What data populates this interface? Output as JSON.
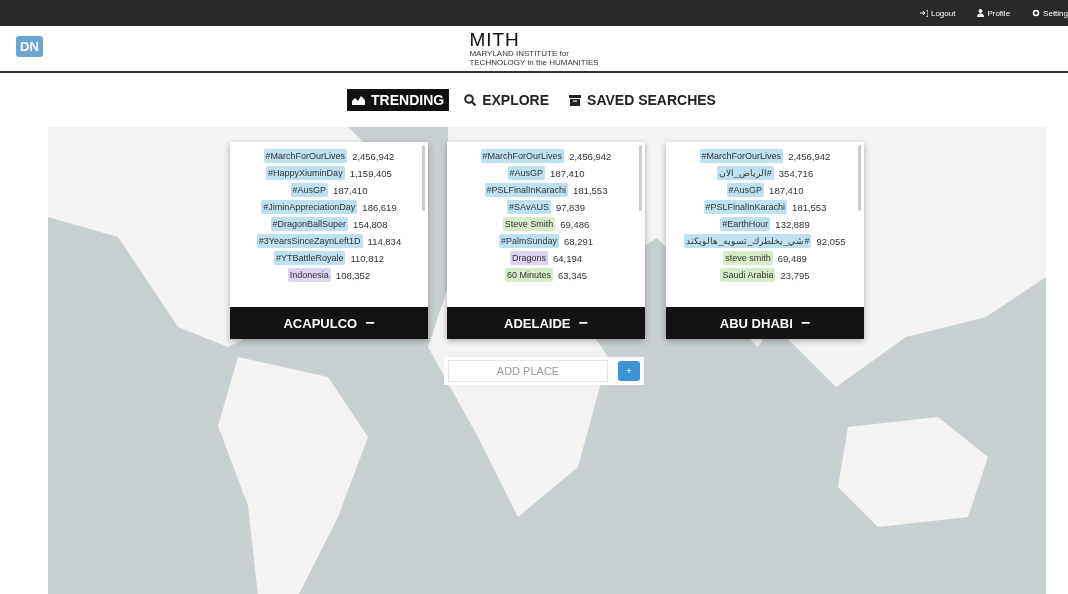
{
  "top_bar": {
    "links": [
      {
        "label": "Logout",
        "kind": "logout"
      },
      {
        "label": "Profile",
        "kind": "person"
      },
      {
        "label": "Setting",
        "kind": "gear"
      }
    ]
  },
  "header": {
    "badge": "DN",
    "logo_title": "MITH",
    "logo_subtitle": [
      "MARYLAND INSTITUTE for",
      "TECHNOLOGY in the HUMANITIES"
    ]
  },
  "tabs": [
    {
      "label": "TRENDING",
      "kind": "chart",
      "selected": true
    },
    {
      "label": "EXPLORE",
      "kind": "search",
      "selected": false
    },
    {
      "label": "SAVED SEARCHES",
      "kind": "box",
      "selected": false
    }
  ],
  "places": [
    {
      "name": "ACAPULCO",
      "collapse": "−",
      "trends": [
        {
          "tag": "#MarchForOurLives",
          "count": "2,456,942",
          "kind": "hashtag"
        },
        {
          "tag": "#HappyXiuminDay",
          "count": "1,159,405",
          "kind": "hashtag"
        },
        {
          "tag": "#AusGP",
          "count": "187,410",
          "kind": "hashtag"
        },
        {
          "tag": "#JiminAppreciationDay",
          "count": "186,619",
          "kind": "hashtag"
        },
        {
          "tag": "#DragonBallSuper",
          "count": "154,808",
          "kind": "hashtag"
        },
        {
          "tag": "#3YearsSinceZaynLeft1D",
          "count": "114,834",
          "kind": "hashtag"
        },
        {
          "tag": "#YTBattleRoyale",
          "count": "110,812",
          "kind": "hashtag"
        },
        {
          "tag": "Indonesia",
          "count": "108,352",
          "kind": "place"
        }
      ]
    },
    {
      "name": "ADELAIDE",
      "collapse": "−",
      "trends": [
        {
          "tag": "#MarchForOurLives",
          "count": "2,456,942",
          "kind": "hashtag"
        },
        {
          "tag": "#AusGP",
          "count": "187,410",
          "kind": "hashtag"
        },
        {
          "tag": "#PSLFinalInKarachi",
          "count": "181,553",
          "kind": "hashtag"
        },
        {
          "tag": "#SAvAUS",
          "count": "97,839",
          "kind": "hashtag"
        },
        {
          "tag": "Steve Smith",
          "count": "69,486",
          "kind": "person"
        },
        {
          "tag": "#PalmSunday",
          "count": "68,291",
          "kind": "hashtag"
        },
        {
          "tag": "Dragons",
          "count": "64,194",
          "kind": "place"
        },
        {
          "tag": "60 Minutes",
          "count": "63,345",
          "kind": "person"
        }
      ]
    },
    {
      "name": "ABU DHABI",
      "collapse": "−",
      "trends": [
        {
          "tag": "#MarchForOurLives",
          "count": "2,456,942",
          "kind": "hashtag"
        },
        {
          "tag": "#الرياض_الان",
          "count": "354,716",
          "kind": "hashtag"
        },
        {
          "tag": "#AusGP",
          "count": "187,410",
          "kind": "hashtag"
        },
        {
          "tag": "#PSLFinalInKarachi",
          "count": "181,553",
          "kind": "hashtag"
        },
        {
          "tag": "#EarthHour",
          "count": "132,889",
          "kind": "hashtag"
        },
        {
          "tag": "#شي_يخلطرك_تسويه_هالويكند",
          "count": "92,055",
          "kind": "hashtag"
        },
        {
          "tag": "steve smith",
          "count": "69,489",
          "kind": "person"
        },
        {
          "tag": "Saudi Arabia",
          "count": "23,795",
          "kind": "person"
        }
      ]
    }
  ],
  "add_place": {
    "placeholder": "ADD PLACE",
    "button": "+"
  }
}
